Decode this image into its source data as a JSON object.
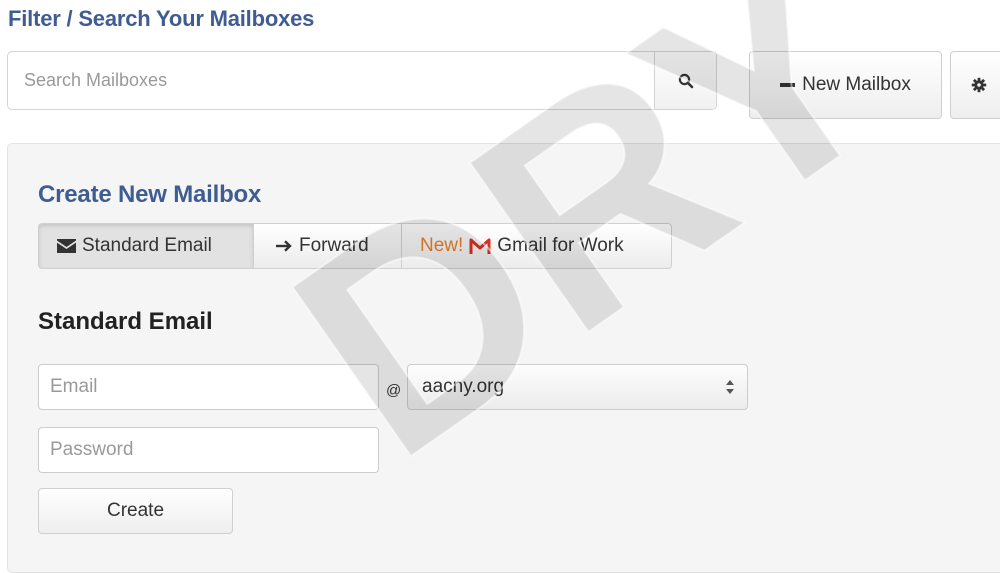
{
  "page": {
    "title": "Filter / Search Your Mailboxes"
  },
  "search": {
    "placeholder": "Search Mailboxes",
    "value": ""
  },
  "toolbar": {
    "new_mailbox_label": "New Mailbox"
  },
  "create_panel": {
    "title": "Create New Mailbox",
    "tabs": [
      {
        "label": "Standard Email",
        "icon": "envelope-icon",
        "active": true
      },
      {
        "label": "Forward",
        "icon": "arrow-right-icon",
        "active": false
      },
      {
        "badge": "New!",
        "label": "Gmail for Work",
        "icon": "gmail-icon",
        "active": false
      }
    ],
    "form": {
      "title": "Standard Email",
      "email_placeholder": "Email",
      "email_value": "",
      "at_sign": "@",
      "domain_value": "aacny.org",
      "password_placeholder": "Password",
      "password_value": "",
      "create_label": "Create"
    }
  },
  "watermark": {
    "text": "DRY"
  },
  "colors": {
    "heading_blue": "#3f5d93",
    "new_badge_orange": "#e8812c",
    "gmail_red": "#d93025",
    "panel_bg": "#f5f5f5"
  }
}
